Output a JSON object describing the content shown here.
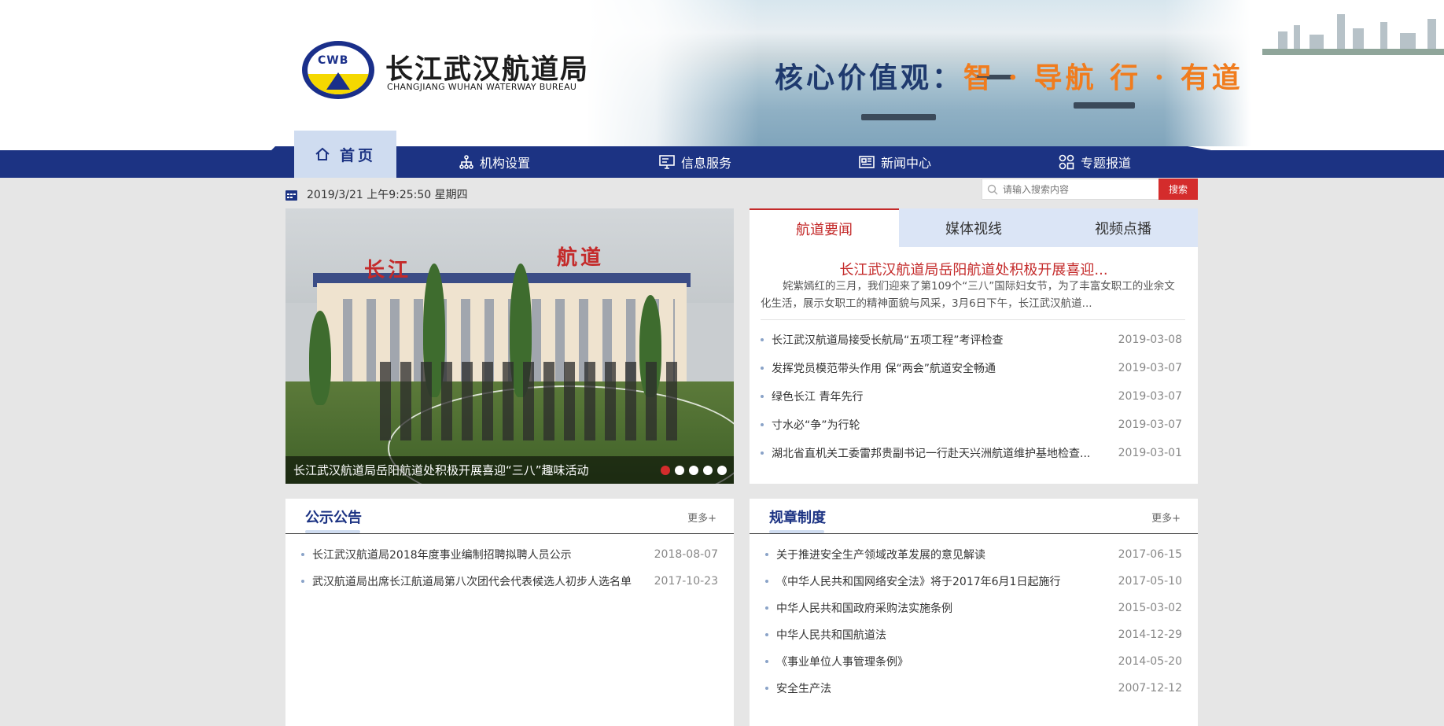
{
  "header": {
    "org_name": "长江武汉航道局",
    "org_name_en": "CHANGJIANG WUHAN WATERWAY BUREAU",
    "logo_text": "CWB",
    "slogan_prefix": "核心价值观：",
    "slogan_main": "智 · 导航  行 · 有道"
  },
  "nav": {
    "items": [
      {
        "label": "首页",
        "icon": "home-icon"
      },
      {
        "label": "机构设置",
        "icon": "org-chart-icon"
      },
      {
        "label": "信息服务",
        "icon": "monitor-icon"
      },
      {
        "label": "新闻中心",
        "icon": "newspaper-icon"
      },
      {
        "label": "专题报道",
        "icon": "grid-icon"
      }
    ]
  },
  "toolbar": {
    "datetime": "2019/3/21 上午9:25:50 星期四",
    "search_placeholder": "请输入搜索内容",
    "search_button": "搜索"
  },
  "slider": {
    "sign_left": "长江",
    "sign_right": "航道",
    "caption": "长江武汉航道局岳阳航道处积极开展喜迎“三八”趣味活动",
    "dots": 5,
    "active_dot": 0
  },
  "news": {
    "tabs": [
      "航道要闻",
      "媒体视线",
      "视频点播"
    ],
    "active_tab": 0,
    "headline": "长江武汉航道局岳阳航道处积极开展喜迎...",
    "summary": "姹紫嫣红的三月，我们迎来了第109个“三八”国际妇女节，为了丰富女职工的业余文化生活，展示女职工的精神面貌与风采，3月6日下午，长江武汉航道...",
    "items": [
      {
        "title": "长江武汉航道局接受长航局“五项工程”考评检查",
        "date": "2019-03-08"
      },
      {
        "title": "发挥党员模范带头作用 保“两会”航道安全畅通",
        "date": "2019-03-07"
      },
      {
        "title": "绿色长江 青年先行",
        "date": "2019-03-07"
      },
      {
        "title": "寸水必“争”为行轮",
        "date": "2019-03-07"
      },
      {
        "title": "湖北省直机关工委雷邦贵副书记一行赴天兴洲航道维护基地检查...",
        "date": "2019-03-01"
      }
    ]
  },
  "notices": {
    "title": "公示公告",
    "more": "更多+",
    "items": [
      {
        "title": "长江武汉航道局2018年度事业编制招聘拟聘人员公示",
        "date": "2018-08-07"
      },
      {
        "title": "武汉航道局出席长江航道局第八次团代会代表候选人初步人选名单",
        "date": "2017-10-23"
      }
    ]
  },
  "regulations": {
    "title": "规章制度",
    "more": "更多+",
    "items": [
      {
        "title": "关于推进安全生产领域改革发展的意见解读",
        "date": "2017-06-15"
      },
      {
        "title": "《中华人民共和国网络安全法》将于2017年6月1日起施行",
        "date": "2017-05-10"
      },
      {
        "title": "中华人民共和国政府采购法实施条例",
        "date": "2015-03-02"
      },
      {
        "title": "中华人民共和国航道法",
        "date": "2014-12-29"
      },
      {
        "title": "《事业单位人事管理条例》",
        "date": "2014-05-20"
      },
      {
        "title": "安全生产法",
        "date": "2007-12-12"
      }
    ]
  },
  "colors": {
    "nav_bg": "#1c3383",
    "accent_red": "#c42a2a",
    "tab_bg": "#dbe5f6",
    "page_bg": "#e6e6e6"
  }
}
